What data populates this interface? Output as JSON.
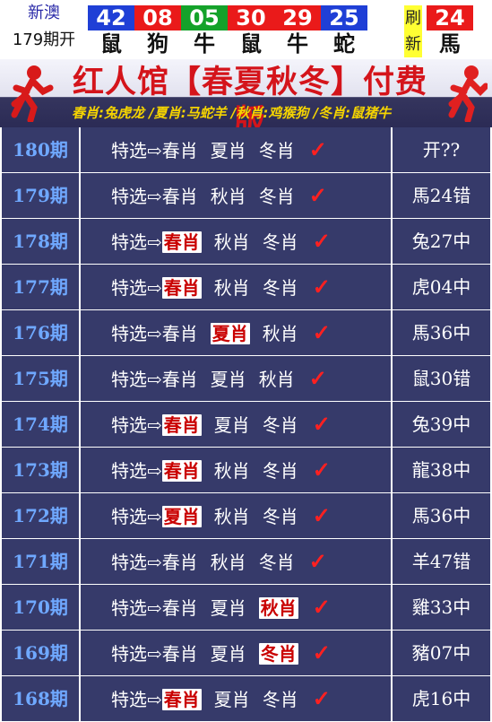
{
  "header": {
    "brand": "新澳",
    "draw_label": "179期开",
    "balls": [
      {
        "num": "42",
        "zodiac": "鼠",
        "color": "blue"
      },
      {
        "num": "08",
        "zodiac": "狗",
        "color": "red"
      },
      {
        "num": "05",
        "zodiac": "牛",
        "color": "green"
      },
      {
        "num": "30",
        "zodiac": "鼠",
        "color": "red"
      },
      {
        "num": "29",
        "zodiac": "牛",
        "color": "red"
      },
      {
        "num": "25",
        "zodiac": "蛇",
        "color": "blue"
      },
      {
        "num": "24",
        "zodiac": "馬",
        "color": "red"
      }
    ],
    "refresh_top": "刷",
    "refresh_bottom": "新"
  },
  "banner": {
    "title": "红人馆【春夏秋冬】付费版",
    "subtitle": "春肖:兔虎龙 /夏肖:马蛇羊 /秋肖:鸡猴狗 /冬肖:鼠猪牛"
  },
  "rows": [
    {
      "issue": "180期",
      "label": "特选⇨",
      "items": [
        "春肖",
        "夏肖",
        "冬肖"
      ],
      "highlight": -1,
      "result": "开??"
    },
    {
      "issue": "179期",
      "label": "特选⇨",
      "items": [
        "春肖",
        "秋肖",
        "冬肖"
      ],
      "highlight": -1,
      "result": "馬24错"
    },
    {
      "issue": "178期",
      "label": "特选⇨",
      "items": [
        "春肖",
        "秋肖",
        "冬肖"
      ],
      "highlight": 0,
      "result": "兔27中"
    },
    {
      "issue": "177期",
      "label": "特选⇨",
      "items": [
        "春肖",
        "秋肖",
        "冬肖"
      ],
      "highlight": 0,
      "result": "虎04中"
    },
    {
      "issue": "176期",
      "label": "特选⇨",
      "items": [
        "春肖",
        "夏肖",
        "秋肖"
      ],
      "highlight": 1,
      "result": "馬36中"
    },
    {
      "issue": "175期",
      "label": "特选⇨",
      "items": [
        "春肖",
        "夏肖",
        "秋肖"
      ],
      "highlight": -1,
      "result": "鼠30错"
    },
    {
      "issue": "174期",
      "label": "特选⇨",
      "items": [
        "春肖",
        "夏肖",
        "冬肖"
      ],
      "highlight": 0,
      "result": "兔39中"
    },
    {
      "issue": "173期",
      "label": "特选⇨",
      "items": [
        "春肖",
        "秋肖",
        "冬肖"
      ],
      "highlight": 0,
      "result": "龍38中"
    },
    {
      "issue": "172期",
      "label": "特选⇨",
      "items": [
        "夏肖",
        "秋肖",
        "冬肖"
      ],
      "highlight": 0,
      "result": "馬36中"
    },
    {
      "issue": "171期",
      "label": "特选⇨",
      "items": [
        "春肖",
        "秋肖",
        "冬肖"
      ],
      "highlight": -1,
      "result": "羊47错"
    },
    {
      "issue": "170期",
      "label": "特选⇨",
      "items": [
        "春肖",
        "夏肖",
        "秋肖"
      ],
      "highlight": 2,
      "result": "雞33中"
    },
    {
      "issue": "169期",
      "label": "特选⇨",
      "items": [
        "春肖",
        "夏肖",
        "冬肖"
      ],
      "highlight": 2,
      "result": "豬07中"
    },
    {
      "issue": "168期",
      "label": "特选⇨",
      "items": [
        "春肖",
        "夏肖",
        "冬肖"
      ],
      "highlight": 0,
      "result": "虎16中"
    }
  ],
  "check_mark": "✓",
  "icons": {
    "runner": "running-man-icon",
    "check": "check-mark-icon"
  },
  "colors": {
    "row_bg": "#363a6a",
    "issue_text": "#6fa8ff",
    "title_red": "#d4141b",
    "subtitle_yellow": "#f5d400",
    "highlight_text": "#c90000"
  }
}
